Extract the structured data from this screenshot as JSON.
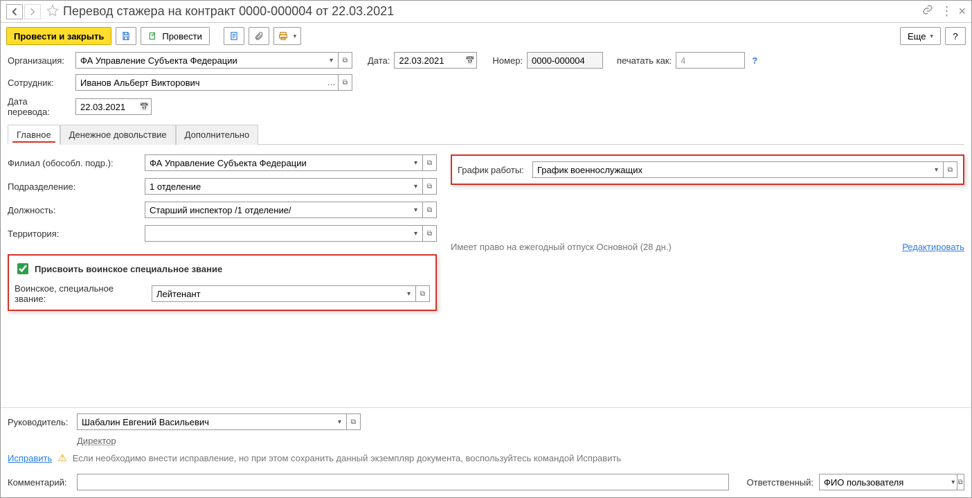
{
  "window": {
    "title": "Перевод стажера на контракт 0000-000004 от 22.03.2021"
  },
  "toolbar": {
    "post_and_close": "Провести и закрыть",
    "post": "Провести",
    "more": "Еще",
    "help": "?"
  },
  "header": {
    "org_label": "Организация:",
    "org_value": "ФА Управление Субъекта Федерации",
    "date_label": "Дата:",
    "date_value": "22.03.2021",
    "number_label": "Номер:",
    "number_value": "0000-000004",
    "print_as_label": "печатать как:",
    "print_as_value": "4",
    "employee_label": "Сотрудник:",
    "employee_value": "Иванов Альберт Викторович",
    "transfer_date_label": "Дата перевода:",
    "transfer_date_value": "22.03.2021"
  },
  "tabs": [
    "Главное",
    "Денежное довольствие",
    "Дополнительно"
  ],
  "active_tab": 0,
  "main": {
    "branch_label": "Филиал (обособл. подр.):",
    "branch_value": "ФА Управление Субъекта Федерации",
    "schedule_label": "График работы:",
    "schedule_value": "График военнослужащих",
    "dept_label": "Подразделение:",
    "dept_value": "1 отделение",
    "position_label": "Должность:",
    "position_value": "Старший инспектор /1 отделение/",
    "territory_label": "Территория:",
    "territory_value": "",
    "vacation_text": "Имеет право на ежегодный отпуск Основной (28 дн.)",
    "edit_link": "Редактировать",
    "assign_rank_checkbox": "Присвоить воинское специальное звание",
    "rank_label": "Воинское, специальное звание:",
    "rank_value": "Лейтенант"
  },
  "footer": {
    "manager_label": "Руководитель:",
    "manager_value": "Шабалин Евгений Васильевич",
    "manager_position": "Директор",
    "fix_link": "Исправить",
    "fix_note": "Если необходимо внести исправление, но при этом сохранить данный экземпляр документа, воспользуйтесь командой Исправить",
    "comment_label": "Комментарий:",
    "comment_value": "",
    "responsible_label": "Ответственный:",
    "responsible_value": "ФИО пользователя"
  }
}
